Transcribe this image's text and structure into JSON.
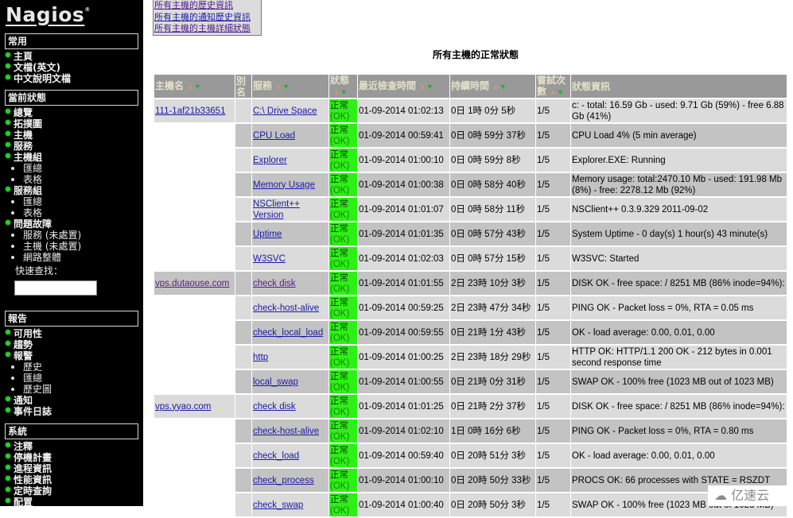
{
  "sidebar": {
    "logo": "Nagios",
    "logo_mark": "®",
    "sections": [
      {
        "header": "常用",
        "items": [
          {
            "label": "主頁"
          },
          {
            "label": "文檔(英文)"
          },
          {
            "label": "中文說明文檔"
          }
        ]
      },
      {
        "header": "當前狀態",
        "items": [
          {
            "label": "總覽"
          },
          {
            "label": "拓撲圖"
          },
          {
            "label": "主機"
          },
          {
            "label": "服務"
          },
          {
            "label": "主機組",
            "subs": [
              "匯總",
              "表格"
            ]
          },
          {
            "label": "服務組",
            "subs": [
              "匯總",
              "表格"
            ]
          },
          {
            "label": "問題故障",
            "subs": [
              "服務 (未處置)",
              "主機 (未處置)",
              "網路整體"
            ]
          }
        ],
        "quick_search_label": "快速查找：",
        "quick_search_value": ""
      },
      {
        "header": "報告",
        "items": [
          {
            "label": "可用性"
          },
          {
            "label": "趨勢"
          },
          {
            "label": "報警",
            "subs": [
              "歷史",
              "匯總",
              "歷史圖"
            ]
          },
          {
            "label": "通知"
          },
          {
            "label": "事件日誌"
          }
        ]
      },
      {
        "header": "系統",
        "items": [
          {
            "label": "注釋"
          },
          {
            "label": "停機計畫"
          },
          {
            "label": "進程資訊"
          },
          {
            "label": "性能資訊"
          },
          {
            "label": "定時查詢"
          },
          {
            "label": "配置"
          }
        ]
      }
    ]
  },
  "top_links": [
    "所有主機的歷史資訊",
    "所有主機的通知歷史資訊",
    "所有主機的主機詳細狀態"
  ],
  "page_title": "所有主機的正常狀態",
  "table": {
    "columns": [
      "主機名",
      "別名",
      "服務",
      "狀態",
      "最近檢查時間",
      "持續時間",
      "嘗試次數",
      "狀態資訊"
    ],
    "status_zh": "正常",
    "status_en": "(OK)",
    "groups": [
      {
        "host": "111-1af21b33651",
        "rows": [
          {
            "service": "C:\\ Drive Space",
            "last_check": "01-09-2014 01:02:13",
            "duration": "0日 1時 0分 5秒",
            "attempt": "1/5",
            "info": "c: - total: 16.59 Gb - used: 9.71 Gb (59%) - free 6.88 Gb (41%)"
          },
          {
            "service": "CPU Load",
            "last_check": "01-09-2014 00:59:41",
            "duration": "0日 0時 59分 37秒",
            "attempt": "1/5",
            "info": "CPU Load 4% (5 min average)"
          },
          {
            "service": "Explorer",
            "last_check": "01-09-2014 01:00:10",
            "duration": "0日 0時 59分 8秒",
            "attempt": "1/5",
            "info": "Explorer.EXE: Running"
          },
          {
            "service": "Memory Usage",
            "last_check": "01-09-2014 01:00:38",
            "duration": "0日 0時 58分 40秒",
            "attempt": "1/5",
            "info": "Memory usage: total:2470.10 Mb - used: 191.98 Mb (8%) - free: 2278.12 Mb (92%)"
          },
          {
            "service": "NSClient++ Version",
            "last_check": "01-09-2014 01:01:07",
            "duration": "0日 0時 58分 11秒",
            "attempt": "1/5",
            "info": "NSClient++ 0.3.9.329 2011-09-02"
          },
          {
            "service": "Uptime",
            "last_check": "01-09-2014 01:01:35",
            "duration": "0日 0時 57分 43秒",
            "attempt": "1/5",
            "info": "System Uptime - 0 day(s) 1 hour(s) 43 minute(s)"
          },
          {
            "service": "W3SVC",
            "last_check": "01-09-2014 01:02:03",
            "duration": "0日 0時 57分 15秒",
            "attempt": "1/5",
            "info": "W3SVC: Started"
          }
        ]
      },
      {
        "host": "vps.dutaouse.com",
        "rows": [
          {
            "service": "check disk",
            "last_check": "01-09-2014 01:01:55",
            "duration": "2日 23時 10分 3秒",
            "attempt": "1/5",
            "info": "DISK OK - free space: / 8251 MB (86% inode=94%):"
          },
          {
            "service": "check-host-alive",
            "last_check": "01-09-2014 00:59:25",
            "duration": "2日 23時 47分 34秒",
            "attempt": "1/5",
            "info": "PING OK - Packet loss = 0%, RTA = 0.05 ms"
          },
          {
            "service": "check_local_load",
            "last_check": "01-09-2014 00:59:55",
            "duration": "0日 21時 1分 43秒",
            "attempt": "1/5",
            "info": "OK - load average: 0.00, 0.01, 0.00"
          },
          {
            "service": "http",
            "last_check": "01-09-2014 01:00:25",
            "duration": "2日 23時 18分 29秒",
            "attempt": "1/5",
            "info": "HTTP OK: HTTP/1.1 200 OK - 212 bytes in 0.001 second response time"
          },
          {
            "service": "local_swap",
            "last_check": "01-09-2014 01:00:55",
            "duration": "0日 21時 0分 31秒",
            "attempt": "1/5",
            "info": "SWAP OK - 100% free (1023 MB out of 1023 MB)"
          }
        ]
      },
      {
        "host": "vps.yyao.com",
        "rows": [
          {
            "service": "check disk",
            "last_check": "01-09-2014 01:01:25",
            "duration": "0日 21時 2分 37秒",
            "attempt": "1/5",
            "info": "DISK OK - free space: / 8251 MB (86% inode=94%):"
          },
          {
            "service": "check-host-alive",
            "last_check": "01-09-2014 01:02:10",
            "duration": "1日 0時 16分 6秒",
            "attempt": "1/5",
            "info": "PING OK - Packet loss = 0%, RTA = 0.80 ms"
          },
          {
            "service": "check_load",
            "last_check": "01-09-2014 00:59:40",
            "duration": "0日 20時 51分 3秒",
            "attempt": "1/5",
            "info": "OK - load average: 0.00, 0.01, 0.00"
          },
          {
            "service": "check_process",
            "last_check": "01-09-2014 01:00:10",
            "duration": "0日 20時 50分 33秒",
            "attempt": "1/5",
            "info": "PROCS OK: 66 processes with STATE = RSZDT"
          },
          {
            "service": "check_swap",
            "last_check": "01-09-2014 01:00:40",
            "duration": "0日 20時 50分 3秒",
            "attempt": "1/5",
            "info": "SWAP OK - 100% free (1023 MB out of 1023 MB)"
          }
        ]
      }
    ]
  },
  "watermark": "亿速云",
  "colors": {
    "status_ok": "#2cf016",
    "header_bg": "#999999",
    "row_light": "#dbdbdb",
    "row_dark": "#c3c3c3",
    "link": "#1a1aa6",
    "link_visited": "#55207f"
  }
}
